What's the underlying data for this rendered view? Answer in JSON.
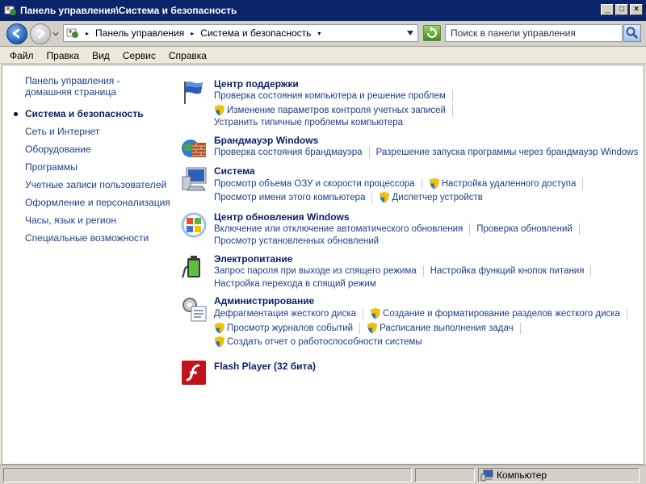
{
  "window": {
    "title": "Панель управления\\Система и безопасность",
    "min_symbol": "_",
    "max_symbol": "□",
    "close_symbol": "×"
  },
  "address": {
    "breadcrumbs": [
      "Панель управления",
      "Система и безопасность"
    ],
    "search_placeholder": "Поиск в панели управления"
  },
  "menu": [
    "Файл",
    "Правка",
    "Вид",
    "Сервис",
    "Справка"
  ],
  "sidebar": {
    "home": "Панель управления - домашняя страница",
    "items": [
      {
        "label": "Система и безопасность",
        "active": true
      },
      {
        "label": "Сеть и Интернет"
      },
      {
        "label": "Оборудование"
      },
      {
        "label": "Программы"
      },
      {
        "label": "Учетные записи пользователей"
      },
      {
        "label": "Оформление и персонализация"
      },
      {
        "label": "Часы, язык и регион"
      },
      {
        "label": "Специальные возможности"
      }
    ]
  },
  "sections": [
    {
      "title": "Центр поддержки",
      "icon": "flag-icon",
      "tasks": [
        "Проверка состояния компьютера и решение проблем",
        "Изменение параметров контроля учетных записей",
        "Устранить типичные проблемы компьютера"
      ]
    },
    {
      "title": "Брандмауэр Windows",
      "icon": "firewall-icon",
      "tasks": [
        "Проверка состояния брандмауэра",
        "Разрешение запуска программы через брандмауэр Windows"
      ]
    },
    {
      "title": "Система",
      "icon": "computer-icon",
      "tasks": [
        "Просмотр объема ОЗУ и скорости процессора",
        "Настройка удаленного доступа",
        "Просмотр имени этого компьютера",
        "Диспетчер устройств"
      ]
    },
    {
      "title": "Центр обновления Windows",
      "icon": "windows-update-icon",
      "tasks": [
        "Включение или отключение автоматического обновления",
        "Проверка обновлений",
        "Просмотр установленных обновлений"
      ]
    },
    {
      "title": "Электропитание",
      "icon": "battery-icon",
      "tasks": [
        "Запрос пароля при выходе из спящего режима",
        "Настройка функций кнопок питания",
        "Настройка перехода в спящий режим"
      ]
    },
    {
      "title": "Администрирование",
      "icon": "admin-tools-icon",
      "tasks": [
        "Дефрагментация жесткого диска",
        "Создание и форматирование разделов жесткого диска",
        "Просмотр журналов событий",
        "Расписание выполнения задач",
        "Создать отчет о работоспособности системы"
      ]
    },
    {
      "title": "Flash Player (32 бита)",
      "icon": "flash-icon",
      "tasks": []
    }
  ],
  "status": {
    "zone": "Компьютер"
  },
  "colors": {
    "link": "#1e3f8a",
    "heading": "#0a1f66",
    "titlebar": "#0a246a"
  }
}
